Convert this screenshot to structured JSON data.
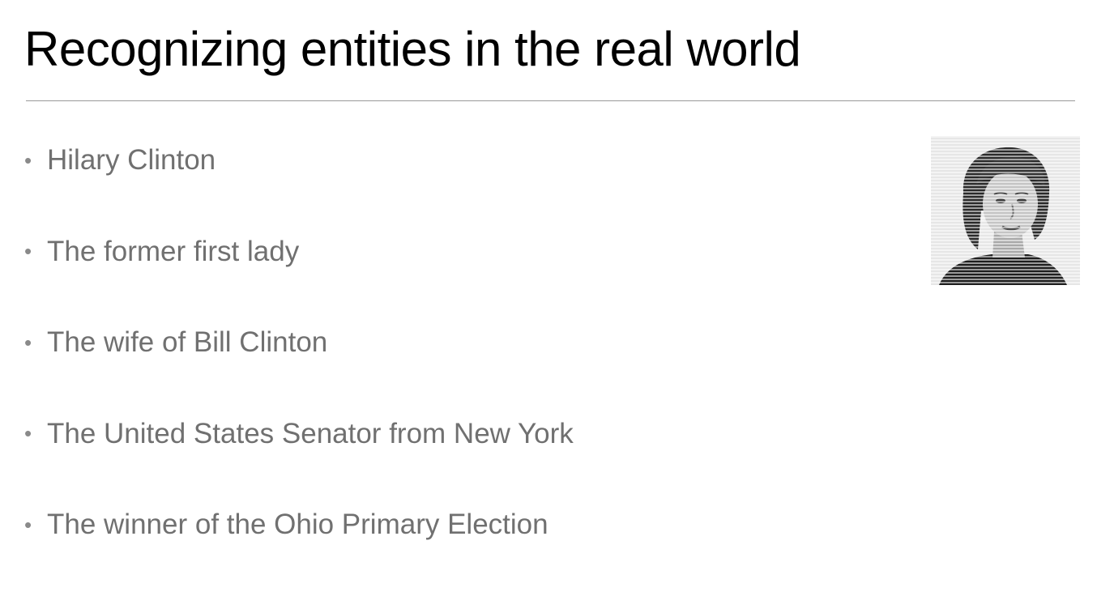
{
  "slide": {
    "title": "Recognizing entities in the real world",
    "bullets": [
      "Hilary Clinton",
      "The former first lady",
      "The wife of Bill Clinton",
      "The United States Senator from New York",
      "The winner of the Ohio Primary Election"
    ],
    "bullet_glyph": "•",
    "photo_icon": "portrait-photo",
    "colors": {
      "title": "#000000",
      "bullet_text": "#707070",
      "rule": "#9a9a9a"
    }
  }
}
